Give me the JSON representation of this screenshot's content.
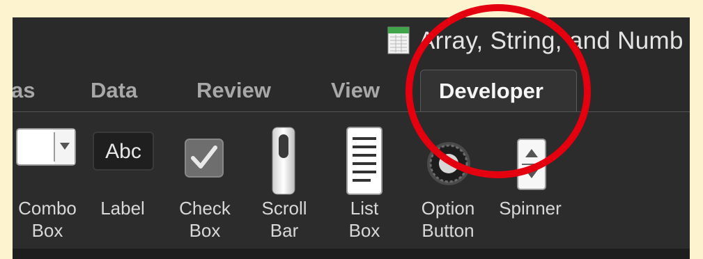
{
  "window": {
    "title": "Array, String, and Numb",
    "doc_icon": "spreadsheet-document-icon"
  },
  "tabs": [
    {
      "label": "as",
      "selected": false
    },
    {
      "label": "Data",
      "selected": false
    },
    {
      "label": "Review",
      "selected": false
    },
    {
      "label": "View",
      "selected": false
    },
    {
      "label": "Developer",
      "selected": true
    }
  ],
  "ribbon": {
    "controls": [
      {
        "label": "Combo\nBox",
        "icon": "combo-box-icon"
      },
      {
        "label": "Label",
        "icon": "label-icon",
        "icon_text": "Abc"
      },
      {
        "label": "Check\nBox",
        "icon": "check-box-icon"
      },
      {
        "label": "Scroll\nBar",
        "icon": "scroll-bar-icon"
      },
      {
        "label": "List\nBox",
        "icon": "list-box-icon"
      },
      {
        "label": "Option\nButton",
        "icon": "option-button-icon"
      },
      {
        "label": "Spinner",
        "icon": "spinner-icon"
      }
    ]
  },
  "colors": {
    "highlight_circle": "#e4000f",
    "page_background": "#fdf3cf",
    "ribbon_background": "#2c2c2c"
  }
}
